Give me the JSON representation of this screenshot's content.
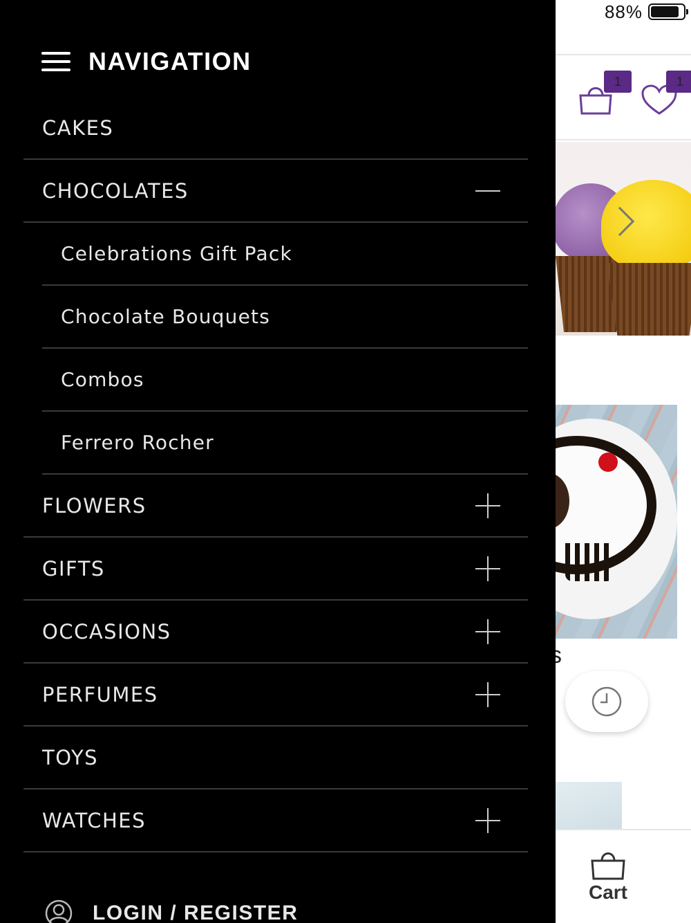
{
  "status_bar": {
    "battery_percent": "88%",
    "battery_level": 0.88
  },
  "header": {
    "cart_badge": "1",
    "wishlist_badge": "1"
  },
  "background": {
    "partial_letter": "s",
    "bottom_bar": {
      "cart_label": "Cart"
    }
  },
  "drawer": {
    "title": "NAVIGATION",
    "items": [
      {
        "label": "CAKES",
        "expandable": false
      },
      {
        "label": "CHOCOLATES",
        "expandable": true,
        "expanded": true,
        "children": [
          {
            "label": "Celebrations Gift Pack"
          },
          {
            "label": "Chocolate Bouquets"
          },
          {
            "label": "Combos"
          },
          {
            "label": "Ferrero Rocher"
          }
        ]
      },
      {
        "label": "FLOWERS",
        "expandable": true,
        "expanded": false
      },
      {
        "label": "GIFTS",
        "expandable": true,
        "expanded": false
      },
      {
        "label": "OCCASIONS",
        "expandable": true,
        "expanded": false
      },
      {
        "label": "PERFUMES",
        "expandable": true,
        "expanded": false
      },
      {
        "label": "TOYS",
        "expandable": false
      },
      {
        "label": "WATCHES",
        "expandable": true,
        "expanded": false
      }
    ],
    "login_label": "LOGIN / REGISTER"
  },
  "colors": {
    "drawer_bg": "#000000",
    "badge": "#5a2a86",
    "icon_accent": "#6a3d9a",
    "divider": "#3a3a3a"
  }
}
